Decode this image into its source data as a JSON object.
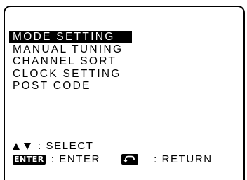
{
  "menu": {
    "items": [
      {
        "label": "MODE SETTING",
        "selected": true
      },
      {
        "label": "MANUAL TUNING",
        "selected": false
      },
      {
        "label": "CHANNEL SORT",
        "selected": false
      },
      {
        "label": "CLOCK SETTING",
        "selected": false
      },
      {
        "label": "POST CODE",
        "selected": false
      }
    ]
  },
  "hints": {
    "select_label": ": SELECT",
    "enter_key": "ENTER",
    "enter_label": ": ENTER",
    "return_label": ": RETURN",
    "select_icons": [
      "up-arrow-icon",
      "down-arrow-icon"
    ],
    "return_icon": "return-arrow-icon"
  }
}
